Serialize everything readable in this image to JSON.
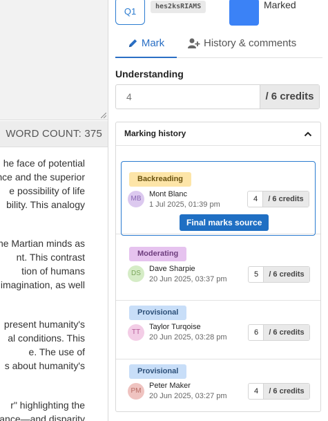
{
  "essay_panel": {
    "word_count": "WORD COUNT: 375",
    "lines": [
      "he face of potential",
      "nce and the superior",
      "e possibility of life",
      "bility. This analogy",
      "he Martian minds as",
      "nt. This contrast",
      "tion of humans",
      "imagination, as well",
      "present humanity's",
      "al conditions. This",
      "e. The use of",
      "s about humanity's",
      "r\" highlighting the",
      "stance—and disparity"
    ]
  },
  "header": {
    "question_label": "Q1",
    "code": "hes2ksRIAMS",
    "status_label": "Marked",
    "status_color": "#3b82f6"
  },
  "tabs": [
    {
      "label": "Mark",
      "icon": "pencil-icon",
      "active": true
    },
    {
      "label": "History & comments",
      "icon": "user-plus-icon",
      "active": false
    }
  ],
  "criterion": {
    "label": "Understanding",
    "placeholder": "4",
    "suffix": "/ 6 credits"
  },
  "history": {
    "title": "Marking history",
    "toggle_icon": "chevron-up-icon",
    "entries": [
      {
        "stage": "Backreading",
        "name": "Mont Blanc",
        "initials": "MB",
        "date": "1 Jul 2025, 01:39 pm",
        "score": "4",
        "suffix": "/ 6 credits",
        "source_button": "Final marks source"
      },
      {
        "stage": "Moderating",
        "name": "Dave Sharpie",
        "initials": "DS",
        "date": "20 Jun 2025, 03:37 pm",
        "score": "5",
        "suffix": "/ 6 credits"
      },
      {
        "stage": "Provisional",
        "name": "Taylor Turqoise",
        "initials": "TT",
        "date": "20 Jun 2025, 03:28 pm",
        "score": "6",
        "suffix": "/ 6 credits"
      },
      {
        "stage": "Provisional",
        "name": "Peter Maker",
        "initials": "PM",
        "date": "20 Jun 2025, 03:27 pm",
        "score": "4",
        "suffix": "/ 6 credits"
      }
    ]
  }
}
